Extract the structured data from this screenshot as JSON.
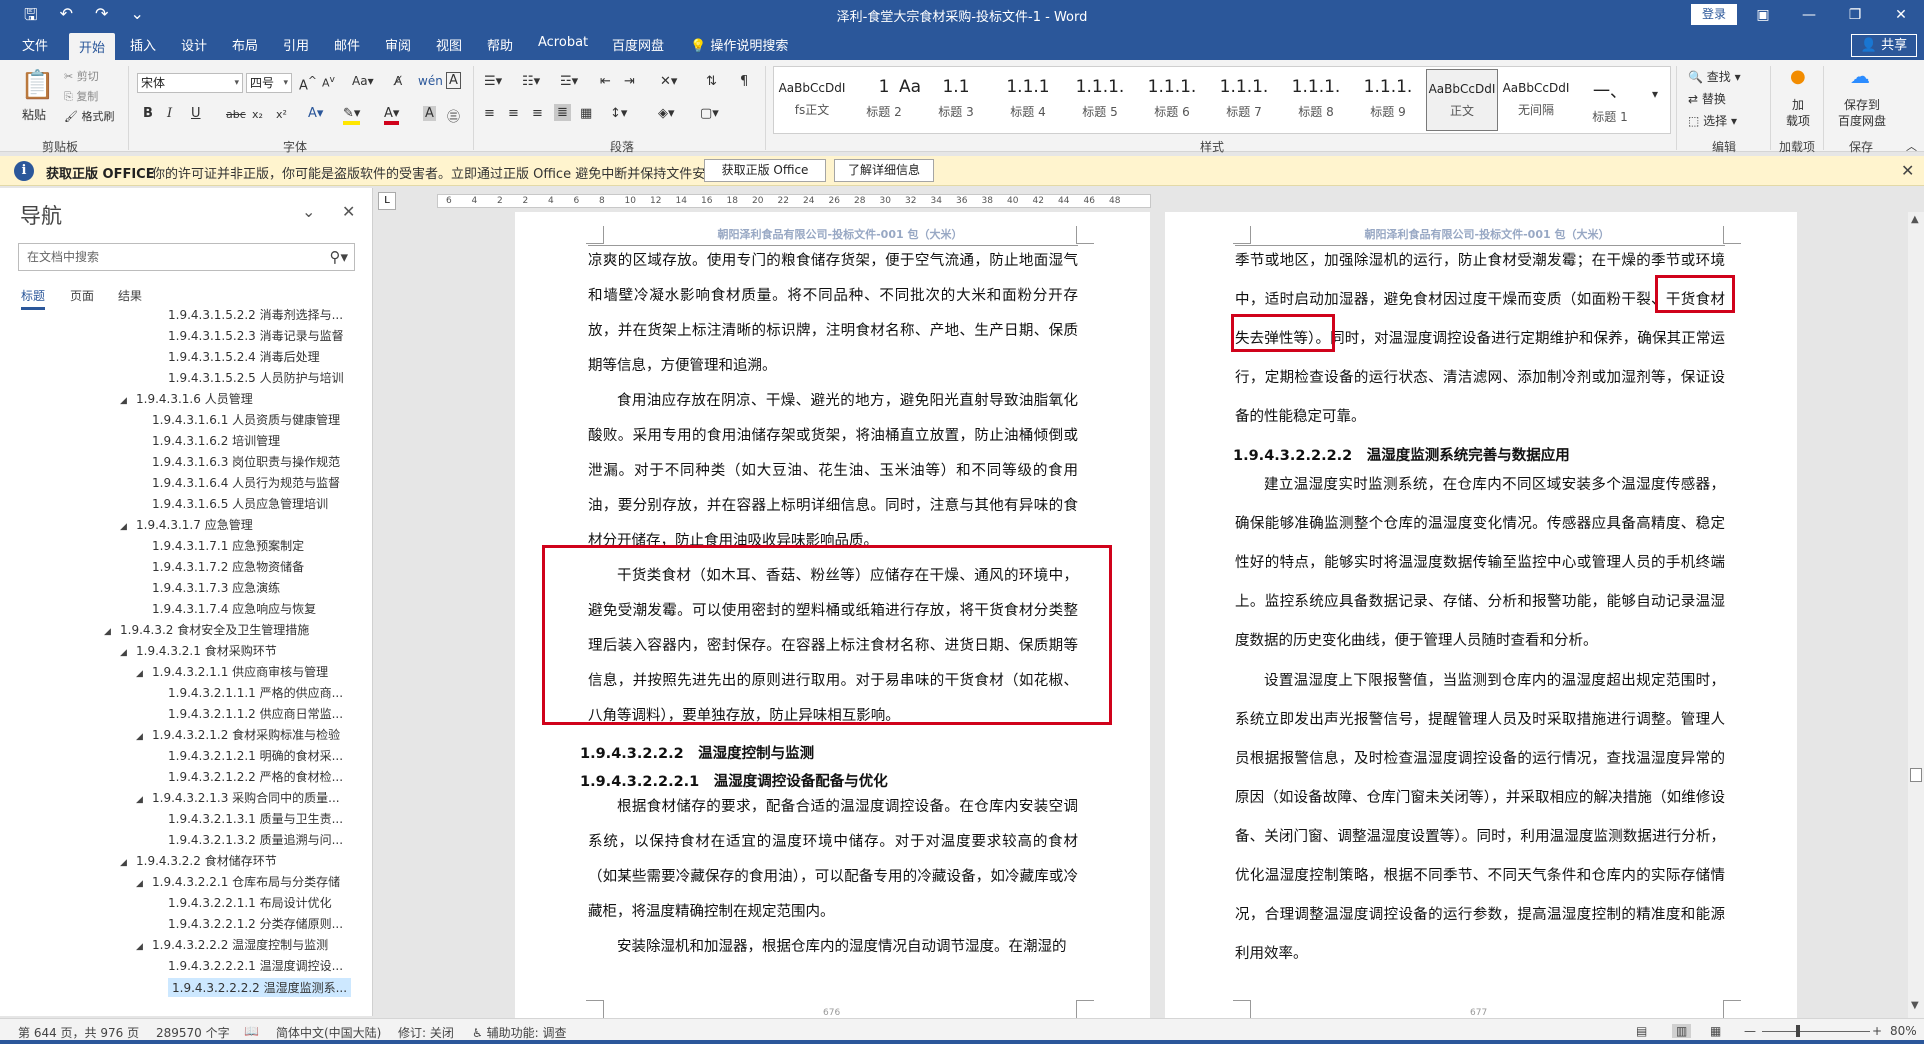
{
  "window": {
    "title": "泽利-食堂大宗食材采购-投标文件-1 - Word",
    "login_label": "登录",
    "share_label": "共享",
    "qa_icons": [
      "save-icon",
      "undo-icon",
      "redo-icon",
      "customize-icon"
    ],
    "win_icons": [
      "ribbon-display-icon",
      "minimize-icon",
      "restore-icon",
      "close-icon"
    ]
  },
  "ribbon_tabs": [
    "文件",
    "开始",
    "插入",
    "设计",
    "布局",
    "引用",
    "邮件",
    "审阅",
    "视图",
    "帮助",
    "Acrobat",
    "百度网盘"
  ],
  "active_tab": "开始",
  "tell_me": "操作说明搜索",
  "clipboard": {
    "paste": "粘贴",
    "cut": "剪切",
    "copy": "复制",
    "format_painter": "格式刷",
    "group": "剪贴板"
  },
  "font": {
    "name": "宋体",
    "size": "四号",
    "group": "字体",
    "buttons": [
      "A",
      "A",
      "Aa",
      "A",
      "B",
      "I",
      "U",
      "abc",
      "x₂",
      "x²",
      "A",
      "A",
      "A",
      "A",
      "A"
    ]
  },
  "paragraph": {
    "group": "段落"
  },
  "styles": {
    "group": "样式",
    "items": [
      {
        "preview": "AaBbCcDdI",
        "name": "fs正文"
      },
      {
        "preview": "1",
        "name": "标题 2"
      },
      {
        "preview": "Aa",
        "name": "标题 3"
      },
      {
        "preview": "1.1",
        "name": "标题 3"
      },
      {
        "preview": "1.1.1",
        "name": "标题 4"
      },
      {
        "preview": "1.1.1.",
        "name": "标题 5"
      },
      {
        "preview": "1.1.1.",
        "name": "标题 6"
      },
      {
        "preview": "1.1.1.",
        "name": "标题 7"
      },
      {
        "preview": "1.1.1.",
        "name": "标题 8"
      },
      {
        "preview": "1.1.1.",
        "name": "标题 9"
      },
      {
        "preview": "AaBbCcDdI",
        "name": "正文"
      },
      {
        "preview": "AaBbCcDdI",
        "name": "无间隔"
      },
      {
        "preview": "一、",
        "name": "标题 1"
      }
    ]
  },
  "editing": {
    "find": "查找",
    "replace": "替换",
    "select": "选择",
    "group": "编辑"
  },
  "addins": {
    "label1": "加",
    "label2": "载项",
    "group": "加载项"
  },
  "baidu": {
    "label1": "保存到",
    "label2": "百度网盘",
    "group": "保存"
  },
  "infobar": {
    "title": "获取正版 OFFICE",
    "message": "你的许可证并非正版，你可能是盗版软件的受害者。立即通过正版 Office 避免中断并保持文件安全。",
    "btn_genuine": "获取正版 Office",
    "btn_learn": "了解详细信息"
  },
  "nav": {
    "title": "导航",
    "search_placeholder": "在文档中搜索",
    "tabs": [
      "标题",
      "页面",
      "结果"
    ],
    "items": [
      {
        "text": "1.9.4.3.1.5.2.2 消毒剂选择与...",
        "level": 4,
        "tri": ""
      },
      {
        "text": "1.9.4.3.1.5.2.3 消毒记录与监督",
        "level": 4,
        "tri": ""
      },
      {
        "text": "1.9.4.3.1.5.2.4 消毒后处理",
        "level": 4,
        "tri": ""
      },
      {
        "text": "1.9.4.3.1.5.2.5 人员防护与培训",
        "level": 4,
        "tri": ""
      },
      {
        "text": "1.9.4.3.1.6 人员管理",
        "level": 2,
        "tri": "◢"
      },
      {
        "text": "1.9.4.3.1.6.1 人员资质与健康管理",
        "level": 3,
        "tri": ""
      },
      {
        "text": "1.9.4.3.1.6.2 培训管理",
        "level": 3,
        "tri": ""
      },
      {
        "text": "1.9.4.3.1.6.3 岗位职责与操作规范",
        "level": 3,
        "tri": ""
      },
      {
        "text": "1.9.4.3.1.6.4 人员行为规范与监督",
        "level": 3,
        "tri": ""
      },
      {
        "text": "1.9.4.3.1.6.5 人员应急管理培训",
        "level": 3,
        "tri": ""
      },
      {
        "text": "1.9.4.3.1.7 应急管理",
        "level": 2,
        "tri": "◢"
      },
      {
        "text": "1.9.4.3.1.7.1 应急预案制定",
        "level": 3,
        "tri": ""
      },
      {
        "text": "1.9.4.3.1.7.2 应急物资储备",
        "level": 3,
        "tri": ""
      },
      {
        "text": "1.9.4.3.1.7.3 应急演练",
        "level": 3,
        "tri": ""
      },
      {
        "text": "1.9.4.3.1.7.4 应急响应与恢复",
        "level": 3,
        "tri": ""
      },
      {
        "text": "1.9.4.3.2 食材安全及卫生管理措施",
        "level": 1,
        "tri": "◢"
      },
      {
        "text": "1.9.4.3.2.1 食材采购环节",
        "level": 2,
        "tri": "◢"
      },
      {
        "text": "1.9.4.3.2.1.1 供应商审核与管理",
        "level": 3,
        "tri": "◢"
      },
      {
        "text": "1.9.4.3.2.1.1.1 严格的供应商...",
        "level": 4,
        "tri": ""
      },
      {
        "text": "1.9.4.3.2.1.1.2 供应商日常监...",
        "level": 4,
        "tri": ""
      },
      {
        "text": "1.9.4.3.2.1.2 食材采购标准与检验",
        "level": 3,
        "tri": "◢"
      },
      {
        "text": "1.9.4.3.2.1.2.1 明确的食材采...",
        "level": 4,
        "tri": ""
      },
      {
        "text": "1.9.4.3.2.1.2.2 严格的食材检...",
        "level": 4,
        "tri": ""
      },
      {
        "text": "1.9.4.3.2.1.3 采购合同中的质量...",
        "level": 3,
        "tri": "◢"
      },
      {
        "text": "1.9.4.3.2.1.3.1 质量与卫生责...",
        "level": 4,
        "tri": ""
      },
      {
        "text": "1.9.4.3.2.1.3.2 质量追溯与问...",
        "level": 4,
        "tri": ""
      },
      {
        "text": "1.9.4.3.2.2 食材储存环节",
        "level": 2,
        "tri": "◢"
      },
      {
        "text": "1.9.4.3.2.2.1 仓库布局与分类存储",
        "level": 3,
        "tri": "◢"
      },
      {
        "text": "1.9.4.3.2.2.1.1 布局设计优化",
        "level": 4,
        "tri": ""
      },
      {
        "text": "1.9.4.3.2.2.1.2 分类存储原则...",
        "level": 4,
        "tri": ""
      },
      {
        "text": "1.9.4.3.2.2.2 温湿度控制与监测",
        "level": 3,
        "tri": "◢"
      },
      {
        "text": "1.9.4.3.2.2.2.1 温湿度调控设...",
        "level": 4,
        "tri": ""
      },
      {
        "text": "1.9.4.3.2.2.2.2 温湿度监测系...",
        "level": 4,
        "tri": "",
        "selected": true
      }
    ]
  },
  "ruler": {
    "corner": "L",
    "numbers": [
      "6",
      "4",
      "2",
      "2",
      "4",
      "6",
      "8",
      "10",
      "12",
      "14",
      "16",
      "18",
      "20",
      "22",
      "24",
      "26",
      "28",
      "30",
      "32",
      "34",
      "36",
      "38",
      "40",
      "42",
      "44",
      "46",
      "48"
    ]
  },
  "pages": {
    "header": "朝阳泽利食品有限公司-投标文件-001 包（大米）",
    "left": {
      "p1": "凉爽的区域存放。使用专门的粮食储存货架，便于空气流通，防止地面湿气和墙壁冷凝水影响食材质量。将不同品种、不同批次的大米和面粉分开存放，并在货架上标注清晰的标识牌，注明食材名称、产地、生产日期、保质期等信息，方便管理和追溯。",
      "p2": "食用油应存放在阴凉、干燥、避光的地方，避免阳光直射导致油脂氧化酸败。采用专用的食用油储存架或货架，将油桶直立放置，防止油桶倾倒或泄漏。对于不同种类（如大豆油、花生油、玉米油等）和不同等级的食用油，要分别存放，并在容器上标明详细信息。同时，注意与其他有异味的食材分开储存，防止食用油吸收异味影响品质。",
      "p3": "干货类食材（如木耳、香菇、粉丝等）应储存在干燥、通风的环境中，避免受潮发霉。可以使用密封的塑料桶或纸箱进行存放，将干货食材分类整理后装入容器内，密封保存。在容器上标注食材名称、进货日期、保质期等信息，并按照先进先出的原则进行取用。对于易串味的干货食材（如花椒、八角等调料），要单独存放，防止异味相互影响。",
      "h1": "1.9.4.3.2.2.2　温湿度控制与监测",
      "h2": "1.9.4.3.2.2.2.1　温湿度调控设备配备与优化",
      "p4": "根据食材储存的要求，配备合适的温湿度调控设备。在仓库内安装空调系统，以保持食材在适宜的温度环境中储存。对于对温度要求较高的食材（如某些需要冷藏保存的食用油），可以配备专用的冷藏设备，如冷藏库或冷藏柜，将温度精确控制在规定范围内。",
      "p5": "安装除湿机和加湿器，根据仓库内的湿度情况自动调节湿度。在潮湿的",
      "page_num": "676"
    },
    "right": {
      "p1": "季节或地区，加强除湿机的运行，防止食材受潮发霉；在干燥的季节或环境中，适时启动加湿器，避免食材因过度干燥而变质（如面粉干裂、干货食材失去弹性等）。同时，对温湿度调控设备进行定期维护和保养，确保其正常运行，定期检查设备的运行状态、清洁滤网、添加制冷剂或加湿剂等，保证设备的性能稳定可靠。",
      "h1": "1.9.4.3.2.2.2.2　温湿度监测系统完善与数据应用",
      "p2": "建立温湿度实时监测系统，在仓库内不同区域安装多个温湿度传感器，确保能够准确监测整个仓库的温湿度变化情况。传感器应具备高精度、稳定性好的特点，能够实时将温湿度数据传输至监控中心或管理人员的手机终端上。监控系统应具备数据记录、存储、分析和报警功能，能够自动记录温湿度数据的历史变化曲线，便于管理人员随时查看和分析。",
      "p3": "设置温湿度上下限报警值，当监测到仓库内的温湿度超出规定范围时，系统立即发出声光报警信号，提醒管理人员及时采取措施进行调整。管理人员根据报警信息，及时检查温湿度调控设备的运行情况，查找温湿度异常的原因（如设备故障、仓库门窗未关闭等），并采取相应的解决措施（如维修设备、关闭门窗、调整温湿度设置等）。同时，利用温湿度监测数据进行分析，优化温湿度控制策略，根据不同季节、不同天气条件和仓库内的实际存储情况，合理调整温湿度调控设备的运行参数，提高温湿度控制的精准度和能源利用效率。",
      "page_num": "677"
    }
  },
  "status": {
    "page": "第 644 页，共 976 页",
    "words": "289570 个字",
    "lang": "简体中文(中国大陆)",
    "track": "修订: 关闭",
    "access": "辅助功能: 调查",
    "zoom": "80%"
  },
  "colors": {
    "brand": "#2b579a",
    "highlight_box": "#d0021b",
    "infobar": "#fff4ce"
  }
}
